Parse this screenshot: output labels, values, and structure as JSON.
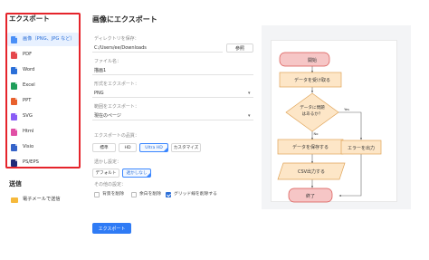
{
  "sidebar": {
    "title": "エクスポート",
    "items": [
      {
        "label": "画像（PNG、JPG など）",
        "icon": "image-file-icon",
        "color": "#4a8ff7",
        "active": true
      },
      {
        "label": "PDF",
        "icon": "pdf-file-icon",
        "color": "#e5484d",
        "active": false
      },
      {
        "label": "Word",
        "icon": "word-file-icon",
        "color": "#2b6fd8",
        "active": false
      },
      {
        "label": "Excel",
        "icon": "excel-file-icon",
        "color": "#1e9e5a",
        "active": false
      },
      {
        "label": "PPT",
        "icon": "ppt-file-icon",
        "color": "#e8602c",
        "active": false
      },
      {
        "label": "SVG",
        "icon": "svg-file-icon",
        "color": "#8a5cf6",
        "active": false
      },
      {
        "label": "Html",
        "icon": "html-file-icon",
        "color": "#e04fa5",
        "active": false
      },
      {
        "label": "Visio",
        "icon": "visio-file-icon",
        "color": "#3563c9",
        "active": false
      },
      {
        "label": "PS/EPS",
        "icon": "ps-file-icon",
        "color": "#1e2a78",
        "active": false
      }
    ]
  },
  "send": {
    "title": "送信",
    "email_label": "電子メールで送信"
  },
  "main": {
    "title": "画像にエクスポート",
    "directory_label": "ディレクトリを保存：",
    "directory_value": "C:/Users/ee/Downloads",
    "browse_label": "参照",
    "filename_label": "ファイル名：",
    "filename_value": "描画1",
    "format_label": "形式をエクスポート：",
    "format_value": "PNG",
    "range_label": "範囲をエクスポート：",
    "range_value": "現在のページ",
    "quality_label": "エクスポートの品質：",
    "quality_options": [
      "標準",
      "HD",
      "Ultra HD",
      "カスタマイズ"
    ],
    "quality_selected": "Ultra HD",
    "transparency_label": "透かし設定：",
    "transparency_options": [
      "デフォルト",
      "透かしなし"
    ],
    "transparency_selected": "透かしなし",
    "other_label": "その他の設定：",
    "checkboxes": [
      {
        "label": "背景を削除",
        "checked": false
      },
      {
        "label": "余白を削除",
        "checked": false
      },
      {
        "label": "グリッド線を削除する",
        "checked": true
      }
    ],
    "export_button": "エクスポート"
  },
  "preview": {
    "start": "開始",
    "receive": "データを受け取る",
    "decision": "データに問題はあるか？",
    "yes": "Yes",
    "no": "No",
    "save": "データを保存する",
    "output_csv": "CSV出力する",
    "error": "エラーを出力",
    "end": "終了"
  },
  "colors": {
    "accent": "#2f7bf5",
    "highlight_border": "#e5242b",
    "flow_pink": "#f6c6c6",
    "flow_pink_border": "#d9534f",
    "flow_orange": "#fde6c7",
    "flow_orange_border": "#e0a458"
  }
}
